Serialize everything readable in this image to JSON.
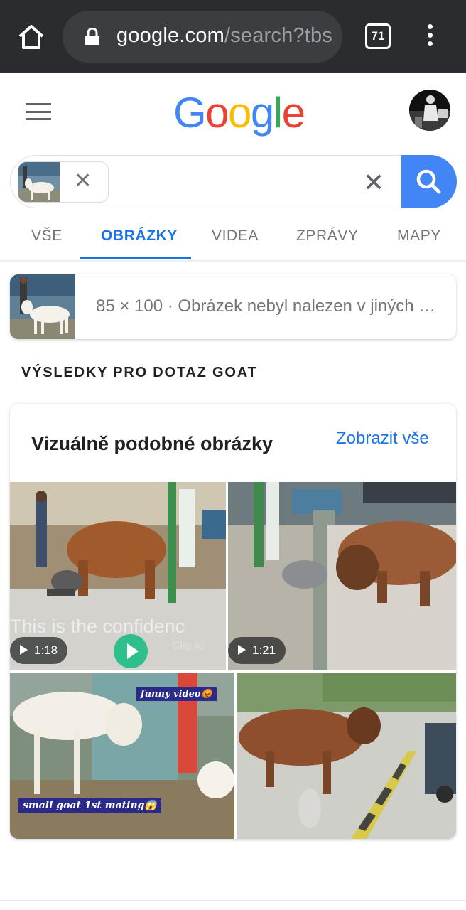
{
  "browser": {
    "url_main": "google.com",
    "url_path": "/search?tbs",
    "tab_count": "71",
    "icons": [
      "home-icon",
      "lock-icon",
      "tabs-icon",
      "overflow-menu-icon"
    ]
  },
  "header": {
    "logo_letters": [
      {
        "char": "G",
        "color": "#4285F4"
      },
      {
        "char": "o",
        "color": "#EA4335"
      },
      {
        "char": "o",
        "color": "#FBBC05"
      },
      {
        "char": "g",
        "color": "#4285F4"
      },
      {
        "char": "l",
        "color": "#34A853"
      },
      {
        "char": "e",
        "color": "#EA4335"
      }
    ]
  },
  "search": {
    "clear_symbol": "✕",
    "chip_remove_symbol": "✕",
    "button_color": "#4285F4"
  },
  "tabs": [
    {
      "label": "VŠE",
      "active": false
    },
    {
      "label": "OBRÁZKY",
      "active": true
    },
    {
      "label": "VIDEA",
      "active": false
    },
    {
      "label": "ZPRÁVY",
      "active": false
    },
    {
      "label": "MAPY",
      "active": false
    }
  ],
  "image_info": {
    "text": "85 × 100 · Obrázek nebyl nalezen v jiných …"
  },
  "results_heading": "VÝSLEDKY PRO DOTAZ GOAT",
  "similar": {
    "title": "Vizuálně podobné obrázky",
    "view_all": "Zobrazit vše",
    "items": [
      {
        "duration": "1:18",
        "overlay": "This is the confidenc",
        "overlay2": "Clip idi"
      },
      {
        "duration": "1:21"
      },
      {
        "caption_top": "funny video😡",
        "caption_bottom": "small goat 1st mating😱"
      },
      {}
    ]
  },
  "colors": {
    "accent": "#1a73e8",
    "chrome": "#2b2c2f"
  }
}
